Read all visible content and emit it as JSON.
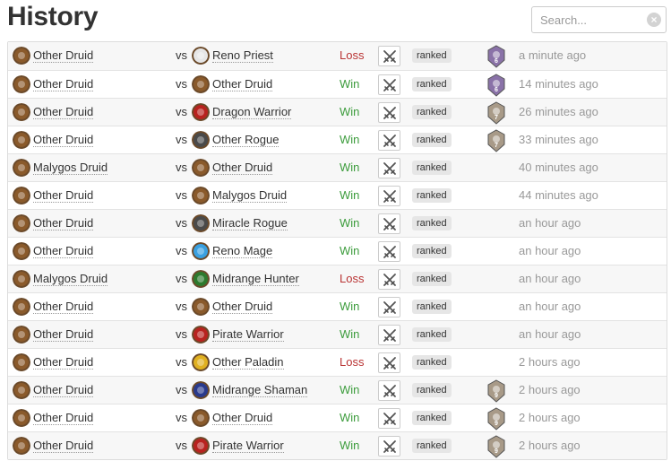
{
  "page": {
    "title": "History"
  },
  "search": {
    "placeholder": "Search...",
    "value": ""
  },
  "icons": {
    "search_clear": "clear-x-icon",
    "swords": "crossed-swords-icon",
    "rank": "rank-medal-icon"
  },
  "colors": {
    "win": "#3c9c3c",
    "loss": "#b93333",
    "badge_bg": "#e6e6e6",
    "time": "#999999"
  },
  "class_colors": {
    "druid": "#8a5a2b",
    "priest": "#e6e6e6",
    "warrior": "#b8231f",
    "rogue": "#4a4a4a",
    "mage": "#3aa0e0",
    "hunter": "#2d7a2d",
    "paladin": "#e0b020",
    "shaman": "#2a3a8c"
  },
  "games": [
    {
      "you": "Other Druid",
      "you_class": "druid",
      "vs": "vs",
      "opp": "Reno Priest",
      "opp_class": "priest",
      "result": "Loss",
      "mode": "ranked",
      "rank": "6",
      "rank_color": "#8a72a8",
      "time": "a minute ago"
    },
    {
      "you": "Other Druid",
      "you_class": "druid",
      "vs": "vs",
      "opp": "Other Druid",
      "opp_class": "druid",
      "result": "Win",
      "mode": "ranked",
      "rank": "6",
      "rank_color": "#8a72a8",
      "time": "14 minutes ago"
    },
    {
      "you": "Other Druid",
      "you_class": "druid",
      "vs": "vs",
      "opp": "Dragon Warrior",
      "opp_class": "warrior",
      "result": "Win",
      "mode": "ranked",
      "rank": "7",
      "rank_color": "#a89a88",
      "time": "26 minutes ago"
    },
    {
      "you": "Other Druid",
      "you_class": "druid",
      "vs": "vs",
      "opp": "Other Rogue",
      "opp_class": "rogue",
      "result": "Win",
      "mode": "ranked",
      "rank": "7",
      "rank_color": "#a89a88",
      "time": "33 minutes ago"
    },
    {
      "you": "Malygos Druid",
      "you_class": "druid",
      "vs": "vs",
      "opp": "Other Druid",
      "opp_class": "druid",
      "result": "Win",
      "mode": "ranked",
      "rank": "",
      "rank_color": "",
      "time": "40 minutes ago"
    },
    {
      "you": "Other Druid",
      "you_class": "druid",
      "vs": "vs",
      "opp": "Malygos Druid",
      "opp_class": "druid",
      "result": "Win",
      "mode": "ranked",
      "rank": "",
      "rank_color": "",
      "time": "44 minutes ago"
    },
    {
      "you": "Other Druid",
      "you_class": "druid",
      "vs": "vs",
      "opp": "Miracle Rogue",
      "opp_class": "rogue",
      "result": "Win",
      "mode": "ranked",
      "rank": "",
      "rank_color": "",
      "time": "an hour ago"
    },
    {
      "you": "Other Druid",
      "you_class": "druid",
      "vs": "vs",
      "opp": "Reno Mage",
      "opp_class": "mage",
      "result": "Win",
      "mode": "ranked",
      "rank": "",
      "rank_color": "",
      "time": "an hour ago"
    },
    {
      "you": "Malygos Druid",
      "you_class": "druid",
      "vs": "vs",
      "opp": "Midrange Hunter",
      "opp_class": "hunter",
      "result": "Loss",
      "mode": "ranked",
      "rank": "",
      "rank_color": "",
      "time": "an hour ago"
    },
    {
      "you": "Other Druid",
      "you_class": "druid",
      "vs": "vs",
      "opp": "Other Druid",
      "opp_class": "druid",
      "result": "Win",
      "mode": "ranked",
      "rank": "",
      "rank_color": "",
      "time": "an hour ago"
    },
    {
      "you": "Other Druid",
      "you_class": "druid",
      "vs": "vs",
      "opp": "Pirate Warrior",
      "opp_class": "warrior",
      "result": "Win",
      "mode": "ranked",
      "rank": "",
      "rank_color": "",
      "time": "an hour ago"
    },
    {
      "you": "Other Druid",
      "you_class": "druid",
      "vs": "vs",
      "opp": "Other Paladin",
      "opp_class": "paladin",
      "result": "Loss",
      "mode": "ranked",
      "rank": "",
      "rank_color": "",
      "time": "2 hours ago"
    },
    {
      "you": "Other Druid",
      "you_class": "druid",
      "vs": "vs",
      "opp": "Midrange Shaman",
      "opp_class": "shaman",
      "result": "Win",
      "mode": "ranked",
      "rank": "9",
      "rank_color": "#a89a88",
      "time": "2 hours ago"
    },
    {
      "you": "Other Druid",
      "you_class": "druid",
      "vs": "vs",
      "opp": "Other Druid",
      "opp_class": "druid",
      "result": "Win",
      "mode": "ranked",
      "rank": "9",
      "rank_color": "#a89a88",
      "time": "2 hours ago"
    },
    {
      "you": "Other Druid",
      "you_class": "druid",
      "vs": "vs",
      "opp": "Pirate Warrior",
      "opp_class": "warrior",
      "result": "Win",
      "mode": "ranked",
      "rank": "9",
      "rank_color": "#a89a88",
      "time": "2 hours ago"
    }
  ]
}
